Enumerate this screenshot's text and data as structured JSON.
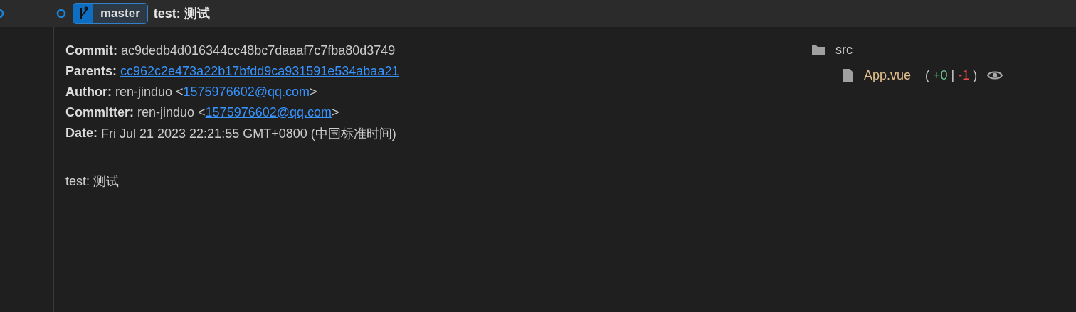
{
  "header": {
    "branch": "master",
    "message": "test: 测试"
  },
  "details": [
    {
      "label": "Commit:",
      "value": "ac9dedb4d016344cc48bc7daaaf7c7fba80d3749"
    },
    {
      "label": "Parents:",
      "link": "cc962c2e473a22b17bfdd9ca931591e534abaa21"
    },
    {
      "label": "Author:",
      "value": "ren-jinduo <",
      "link": "1575976602@qq.com",
      "suffix": ">"
    },
    {
      "label": "Committer:",
      "value": "ren-jinduo <",
      "link": "1575976602@qq.com",
      "suffix": ">"
    },
    {
      "label": "Date:",
      "value": "Fri Jul 21 2023 22:21:55 GMT+0800 (中国标准时间)"
    }
  ],
  "message": "test: 测试",
  "files": [
    {
      "kind": "folder",
      "name": "src",
      "children": [
        {
          "kind": "file",
          "name": "App.vue",
          "open_paren": "(",
          "added": "+0",
          "separator": "|",
          "deleted": "-1",
          "close_paren": ")"
        }
      ]
    }
  ]
}
